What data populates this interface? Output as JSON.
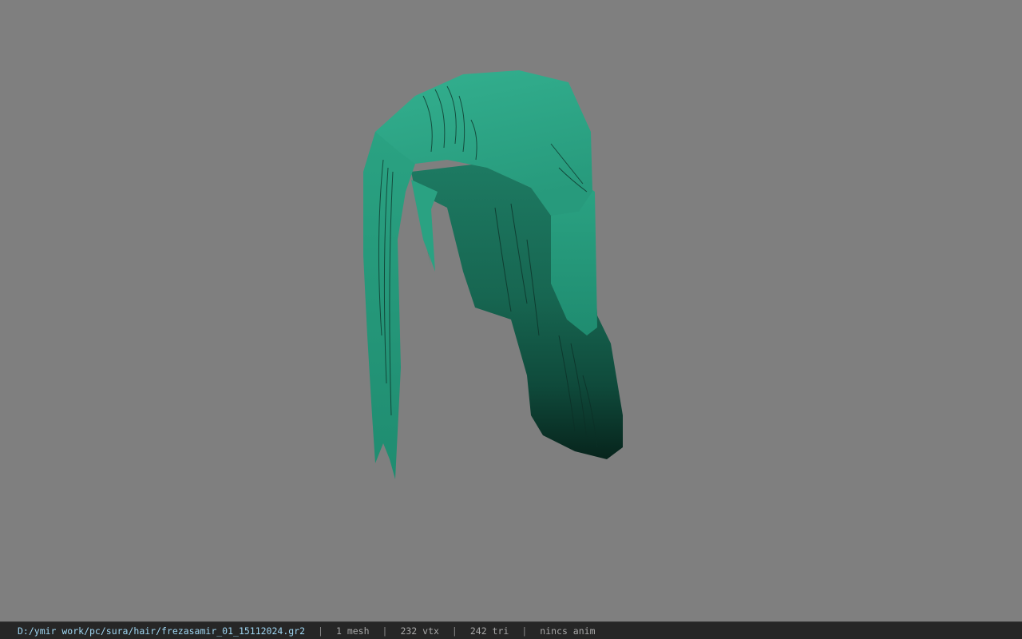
{
  "viewport": {
    "background_color": "#7f7f7f",
    "model": {
      "name": "hair-mesh",
      "base_color": "#2fa486",
      "shadow_color": "#0a2a22"
    }
  },
  "statusbar": {
    "file_path": "D:/ymir work/pc/sura/hair/frezasamir_01_15112024.gr2",
    "separator": "|",
    "mesh_count": "1 mesh",
    "vertex_count": "232 vtx",
    "triangle_count": "242 tri",
    "animation": "nincs anim"
  }
}
